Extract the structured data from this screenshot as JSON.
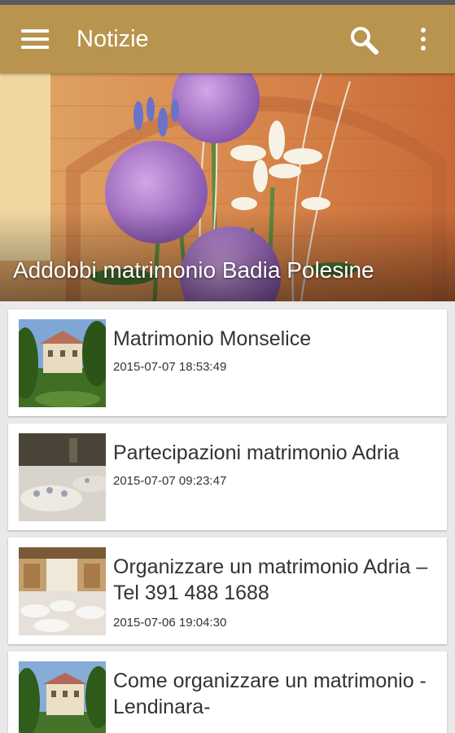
{
  "app_bar": {
    "title": "Notizie",
    "menu_icon": "hamburger-menu-icon",
    "search_icon": "search-icon",
    "more_icon": "more-vert-icon"
  },
  "featured": {
    "title": "Addobbi matrimonio Badia Polesine",
    "image": "wedding-flower-decoration-photo"
  },
  "articles": [
    {
      "title": "Matrimonio Monselice",
      "date": "2015-07-07 18:53:49",
      "thumbnail": "villa-garden-photo"
    },
    {
      "title": "Partecipazioni matrimonio Adria",
      "date": "2015-07-07 09:23:47",
      "thumbnail": "banquet-table-photo"
    },
    {
      "title": "Organizzare un matrimonio Adria – Tel 391 488 1688",
      "date": "2015-07-06 19:04:30",
      "thumbnail": "reception-hall-photo"
    },
    {
      "title": "Come organizzare un matrimonio -Lendinara-",
      "date": "",
      "thumbnail": "villa-garden-photo"
    }
  ],
  "colors": {
    "app_bar": "#b8944f",
    "background": "#e9e9e9",
    "card": "#ffffff",
    "text": "#333333"
  }
}
